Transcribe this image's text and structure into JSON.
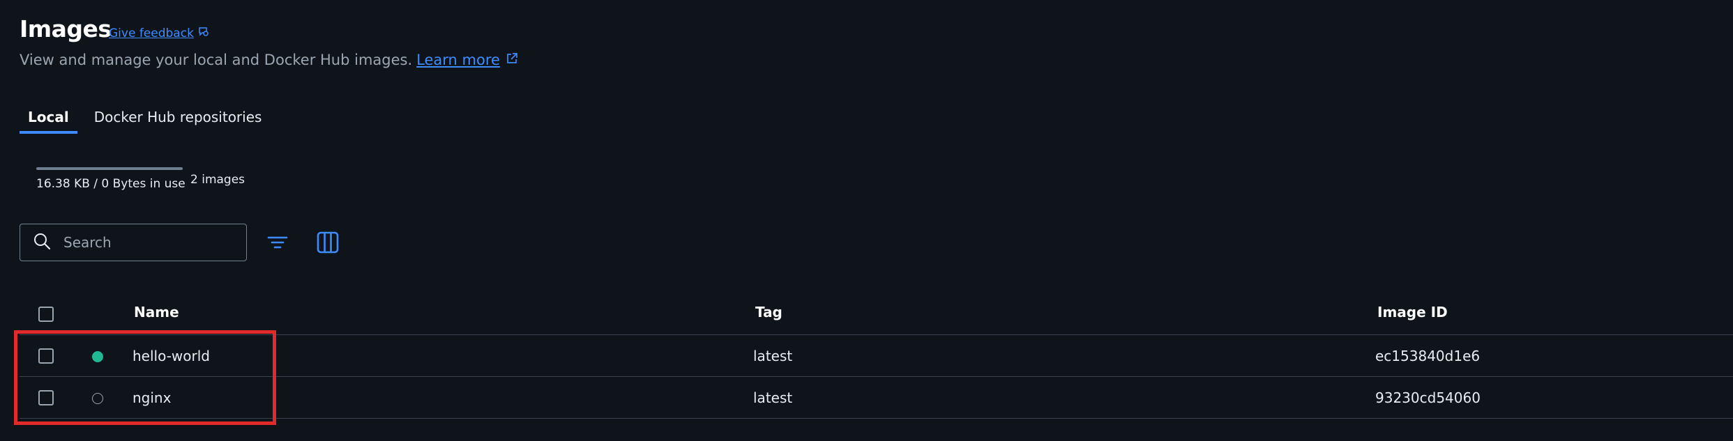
{
  "header": {
    "title": "Images",
    "feedback_label": "Give feedback",
    "subtitle": "View and manage your local and Docker Hub images.",
    "learn_more_label": "Learn more"
  },
  "tabs": [
    {
      "label": "Local",
      "active": true
    },
    {
      "label": "Docker Hub repositories",
      "active": false
    }
  ],
  "usage": {
    "text": "16.38 KB / 0 Bytes in use",
    "count": "2 images"
  },
  "search": {
    "placeholder": "Search"
  },
  "icons": {
    "search": "search-icon",
    "filter": "filter-icon",
    "columns": "columns-icon",
    "external": "external-link-icon"
  },
  "colors": {
    "accent": "#3d8bff",
    "in_use": "#1fb895",
    "background": "#0f141b",
    "highlight": "#e12a2a"
  },
  "table": {
    "columns": [
      "Name",
      "Tag",
      "Image ID"
    ],
    "rows": [
      {
        "name": "hello-world",
        "tag": "latest",
        "image_id": "ec153840d1e6",
        "status": "in-use"
      },
      {
        "name": "nginx",
        "tag": "latest",
        "image_id": "93230cd54060",
        "status": "unused"
      }
    ]
  }
}
